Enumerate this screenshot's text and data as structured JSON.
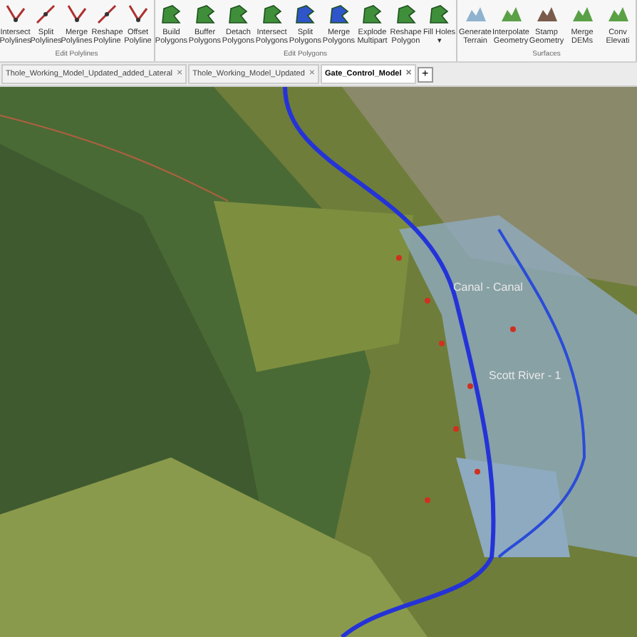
{
  "ribbon": {
    "groups": [
      {
        "kind": "polyline",
        "label": "Edit Polylines",
        "buttons": [
          {
            "label": "Intersect Polylines"
          },
          {
            "label": "Split Polylines"
          },
          {
            "label": "Merge Polylines"
          },
          {
            "label": "Reshape Polyline"
          },
          {
            "label": "Offset Polyline"
          }
        ]
      },
      {
        "kind": "polygon",
        "label": "Edit Polygons",
        "buttons": [
          {
            "label": "Build Polygons"
          },
          {
            "label": "Buffer Polygons"
          },
          {
            "label": "Detach Polygons"
          },
          {
            "label": "Intersect Polygons"
          },
          {
            "label": "Split Polygons"
          },
          {
            "label": "Merge Polygons"
          },
          {
            "label": "Explode Multipart"
          },
          {
            "label": "Reshape Polygon"
          },
          {
            "label": "Fill Holes ▾"
          }
        ]
      },
      {
        "kind": "surface",
        "label": "Surfaces",
        "buttons": [
          {
            "label": "Generate Terrain"
          },
          {
            "label": "Interpolate Geometry"
          },
          {
            "label": "Stamp Geometry"
          },
          {
            "label": "Merge DEMs"
          },
          {
            "label": "Conv Elevati"
          }
        ]
      }
    ]
  },
  "tabs": [
    {
      "label": "Thole_Working_Model_Updated_added_Lateral",
      "close": "×",
      "selected": false
    },
    {
      "label": "Thole_Working_Model_Updated",
      "close": "×",
      "selected": false
    },
    {
      "label": "Gate_Control_Model",
      "close": "×",
      "selected": true
    }
  ],
  "new_tab": "+",
  "map": {
    "labels": [
      "Canal - Canal",
      "Scott River - 1"
    ]
  }
}
